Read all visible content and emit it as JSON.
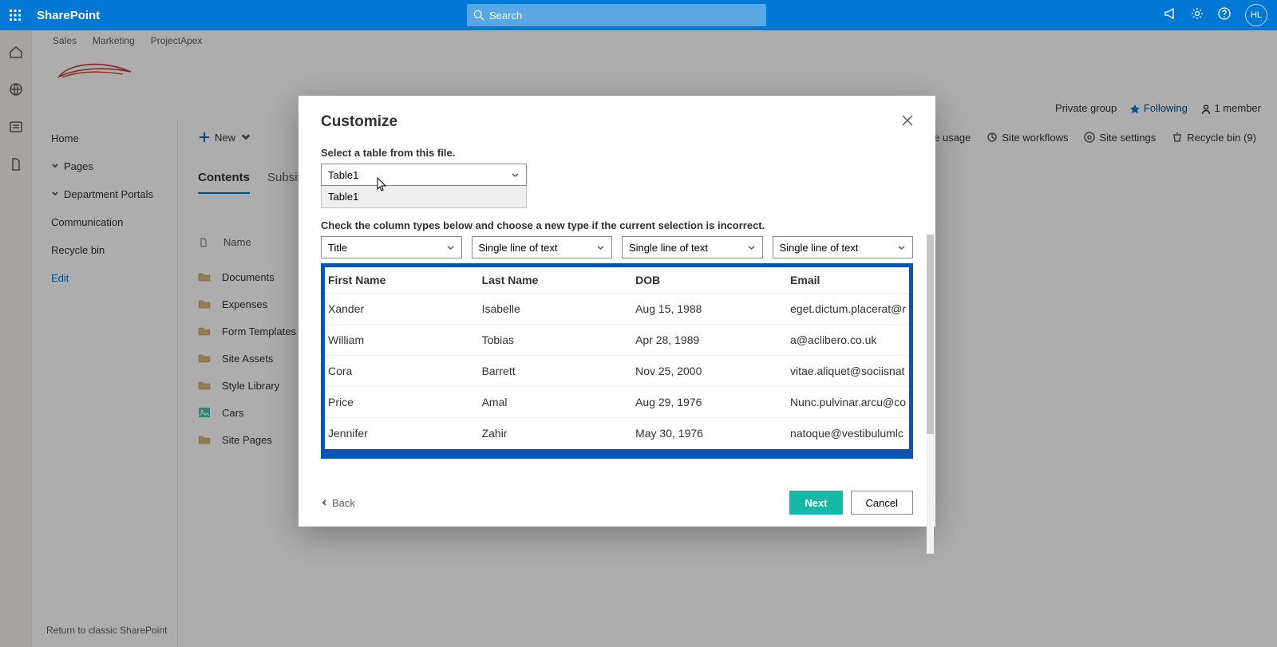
{
  "suite": {
    "app": "SharePoint",
    "search_placeholder": "Search",
    "avatar": "HL"
  },
  "topnav": [
    "Sales",
    "Marketing",
    "ProjectApex"
  ],
  "site_meta": {
    "group": "Private group",
    "following": "Following",
    "members": "1 member"
  },
  "leftnav": {
    "home": "Home",
    "pages": "Pages",
    "dept": "Department Portals",
    "comm": "Communication",
    "recycle": "Recycle bin",
    "edit": "Edit"
  },
  "cmdbar": {
    "new": "New",
    "usage": "Site usage",
    "workflows": "Site workflows",
    "settings": "Site settings",
    "recycle": "Recycle bin (9)"
  },
  "tabs": {
    "contents": "Contents",
    "subsites": "Subsites"
  },
  "list": {
    "colname": "Name",
    "rows": [
      {
        "icon": "folder",
        "name": "Documents"
      },
      {
        "icon": "folder",
        "name": "Expenses"
      },
      {
        "icon": "folder",
        "name": "Form Templates"
      },
      {
        "icon": "folder",
        "name": "Site Assets"
      },
      {
        "icon": "folder",
        "name": "Style Library"
      },
      {
        "icon": "image",
        "name": "Cars"
      },
      {
        "icon": "folder",
        "name": "Site Pages"
      }
    ]
  },
  "modal": {
    "title": "Customize",
    "select_label": "Select a table from this file.",
    "table_selected": "Table1",
    "table_option": "Table1",
    "check_label": "Check the column types below and choose a new type if the current selection is incorrect.",
    "col_types": [
      "Title",
      "Single line of text",
      "Single line of text",
      "Single line of text"
    ],
    "preview": {
      "headers": [
        "First Name",
        "Last Name",
        "DOB",
        "Email"
      ],
      "rows": [
        [
          "Xander",
          "Isabelle",
          "Aug 15, 1988",
          "eget.dictum.placerat@r"
        ],
        [
          "William",
          "Tobias",
          "Apr 28, 1989",
          "a@aclibero.co.uk"
        ],
        [
          "Cora",
          "Barrett",
          "Nov 25, 2000",
          "vitae.aliquet@sociisnat"
        ],
        [
          "Price",
          "Amal",
          "Aug 29, 1976",
          "Nunc.pulvinar.arcu@co"
        ],
        [
          "Jennifer",
          "Zahir",
          "May 30, 1976",
          "natoque@vestibulumlc"
        ]
      ]
    },
    "back": "Back",
    "next": "Next",
    "cancel": "Cancel"
  },
  "return": "Return to classic SharePoint"
}
